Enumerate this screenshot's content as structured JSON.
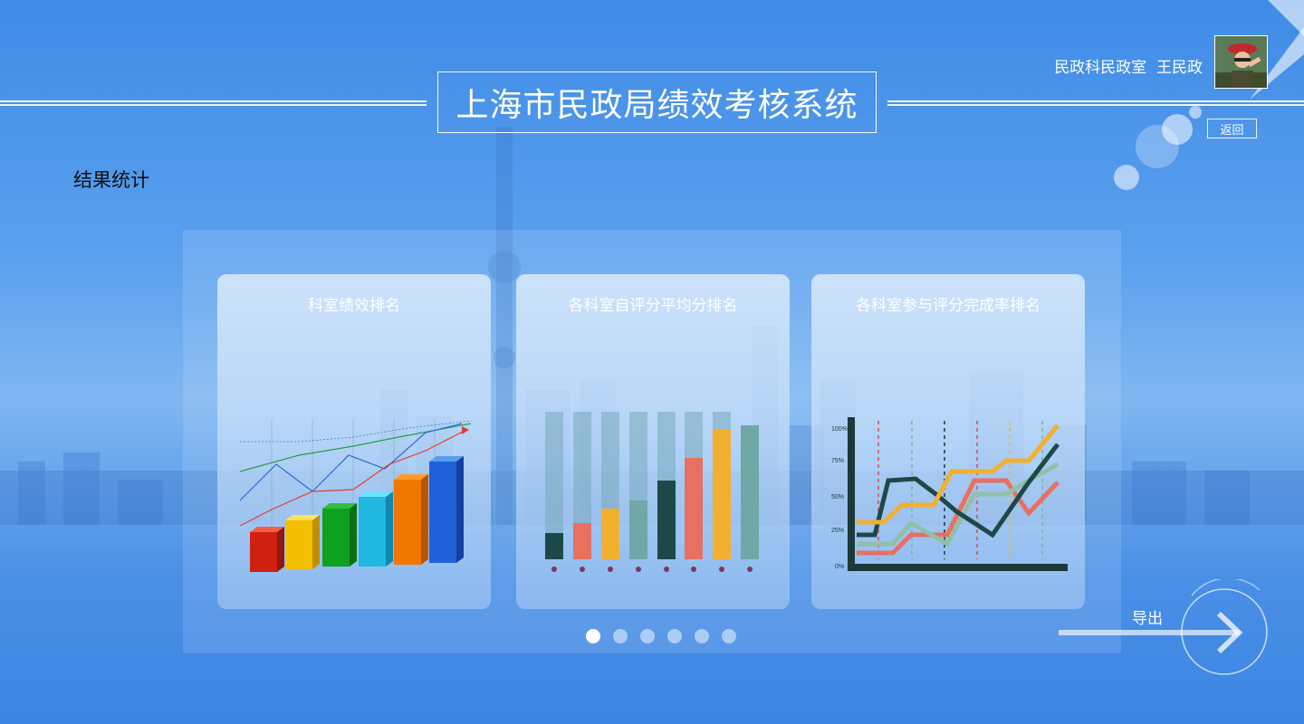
{
  "header": {
    "title": "上海市民政局绩效考核系统",
    "user_text": "民政科民政室  王民政",
    "back_label": "返回"
  },
  "section_title": "结果统计",
  "cards": [
    {
      "title": "科室绩效排名",
      "icon": "3d-bar-chart-icon"
    },
    {
      "title": "各科室自评分平均分排名",
      "icon": "column-chart-icon"
    },
    {
      "title": "各科室参与评分完成率排名",
      "icon": "line-chart-icon",
      "axis_labels": [
        "100%",
        "75%",
        "50%",
        "25%",
        "0%"
      ]
    }
  ],
  "pager": {
    "count": 6,
    "active": 0
  },
  "export_label": "导出",
  "colors": {
    "accent": "#3f8be6",
    "card_bg": "#cfe2f9"
  }
}
